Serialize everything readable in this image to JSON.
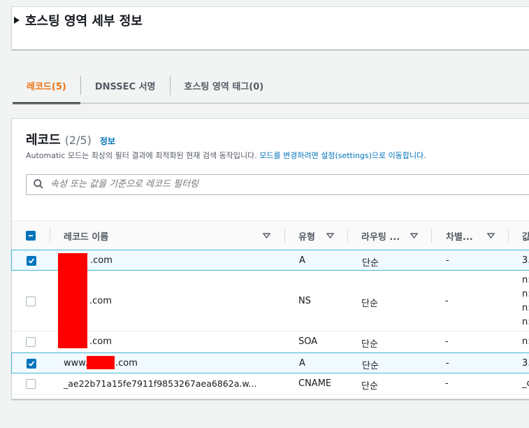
{
  "hosted_zone": {
    "title": "호스팅 영역 세부 정보"
  },
  "tabs": [
    {
      "label": "레코드(5)",
      "active": true
    },
    {
      "label": "DNSSEC 서명",
      "active": false
    },
    {
      "label": "호스팅 영역 태그(0)",
      "active": false
    }
  ],
  "records": {
    "title": "레코드",
    "count": "(2/5)",
    "info": "정보",
    "desc_plain": "Automatic 모드는 최상의 필터 결과에 최적화된 현재 검색 동작입니다. ",
    "desc_link": "모드를 변경하려면 설정(settings)으로 이동합니다.",
    "filter_placeholder": "속성 또는 값을 기준으로 레코드 필터링",
    "columns": [
      "레코드 이름",
      "유형",
      "라우팅 ...",
      "차별...",
      "값"
    ],
    "rows": [
      {
        "name": ".com",
        "type": "A",
        "routing": "단순",
        "diff": "-",
        "value": "3.",
        "checked": true
      },
      {
        "name": ".com",
        "type": "NS",
        "routing": "단순",
        "diff": "-",
        "value_lines": [
          "n:",
          "n:",
          "n:",
          "n:"
        ],
        "checked": false
      },
      {
        "name": ".com",
        "type": "SOA",
        "routing": "단순",
        "diff": "-",
        "value": "n:",
        "checked": false
      },
      {
        "name_prefix": "www.",
        "name": ".com",
        "type": "A",
        "routing": "단순",
        "diff": "-",
        "value": "3.",
        "checked": true
      },
      {
        "name": "_ae22b71a15fe7911f9853267aea6862a.w...",
        "type": "CNAME",
        "routing": "단순",
        "diff": "-",
        "value": "_c",
        "checked": false
      }
    ]
  },
  "colors": {
    "accent": "#ec7211",
    "link": "#0073bb",
    "select_border": "#44b9d6",
    "redaction": "#ff0000"
  }
}
